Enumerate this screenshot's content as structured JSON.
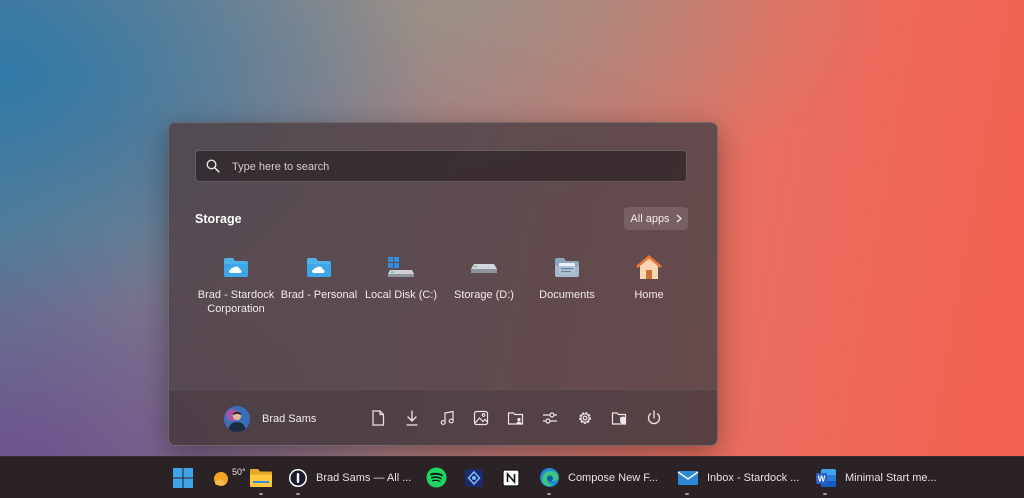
{
  "search": {
    "placeholder": "Type here to search"
  },
  "section": {
    "title": "Storage",
    "all_apps_label": "All apps"
  },
  "tiles": [
    {
      "label": "Brad - Stardock Corporation",
      "icon": "onedrive-folder-icon"
    },
    {
      "label": "Brad - Personal",
      "icon": "onedrive-folder-icon"
    },
    {
      "label": "Local Disk (C:)",
      "icon": "windows-drive-icon"
    },
    {
      "label": "Storage (D:)",
      "icon": "drive-icon"
    },
    {
      "label": "Documents",
      "icon": "documents-folder-icon"
    },
    {
      "label": "Home",
      "icon": "home-icon"
    }
  ],
  "footer": {
    "user_name": "Brad Sams",
    "icons": [
      "documents-icon",
      "downloads-icon",
      "music-icon",
      "pictures-icon",
      "personal-folder-icon",
      "settings-sliders-icon",
      "settings-gear-icon",
      "file-explorer-shield-icon",
      "power-icon"
    ]
  },
  "taskbar": {
    "weather_temp": "50°",
    "onepassword_label": "Brad Sams — All ...",
    "edge_label": "Compose New F...",
    "mail_label": "Inbox - Stardock ...",
    "word_label": "Minimal Start me..."
  },
  "colors": {
    "accent_blue": "#3ea6e8",
    "folder_blue": "#4fb2e6",
    "spotify_green": "#1ed760",
    "word_blue": "#2b5fc4"
  }
}
